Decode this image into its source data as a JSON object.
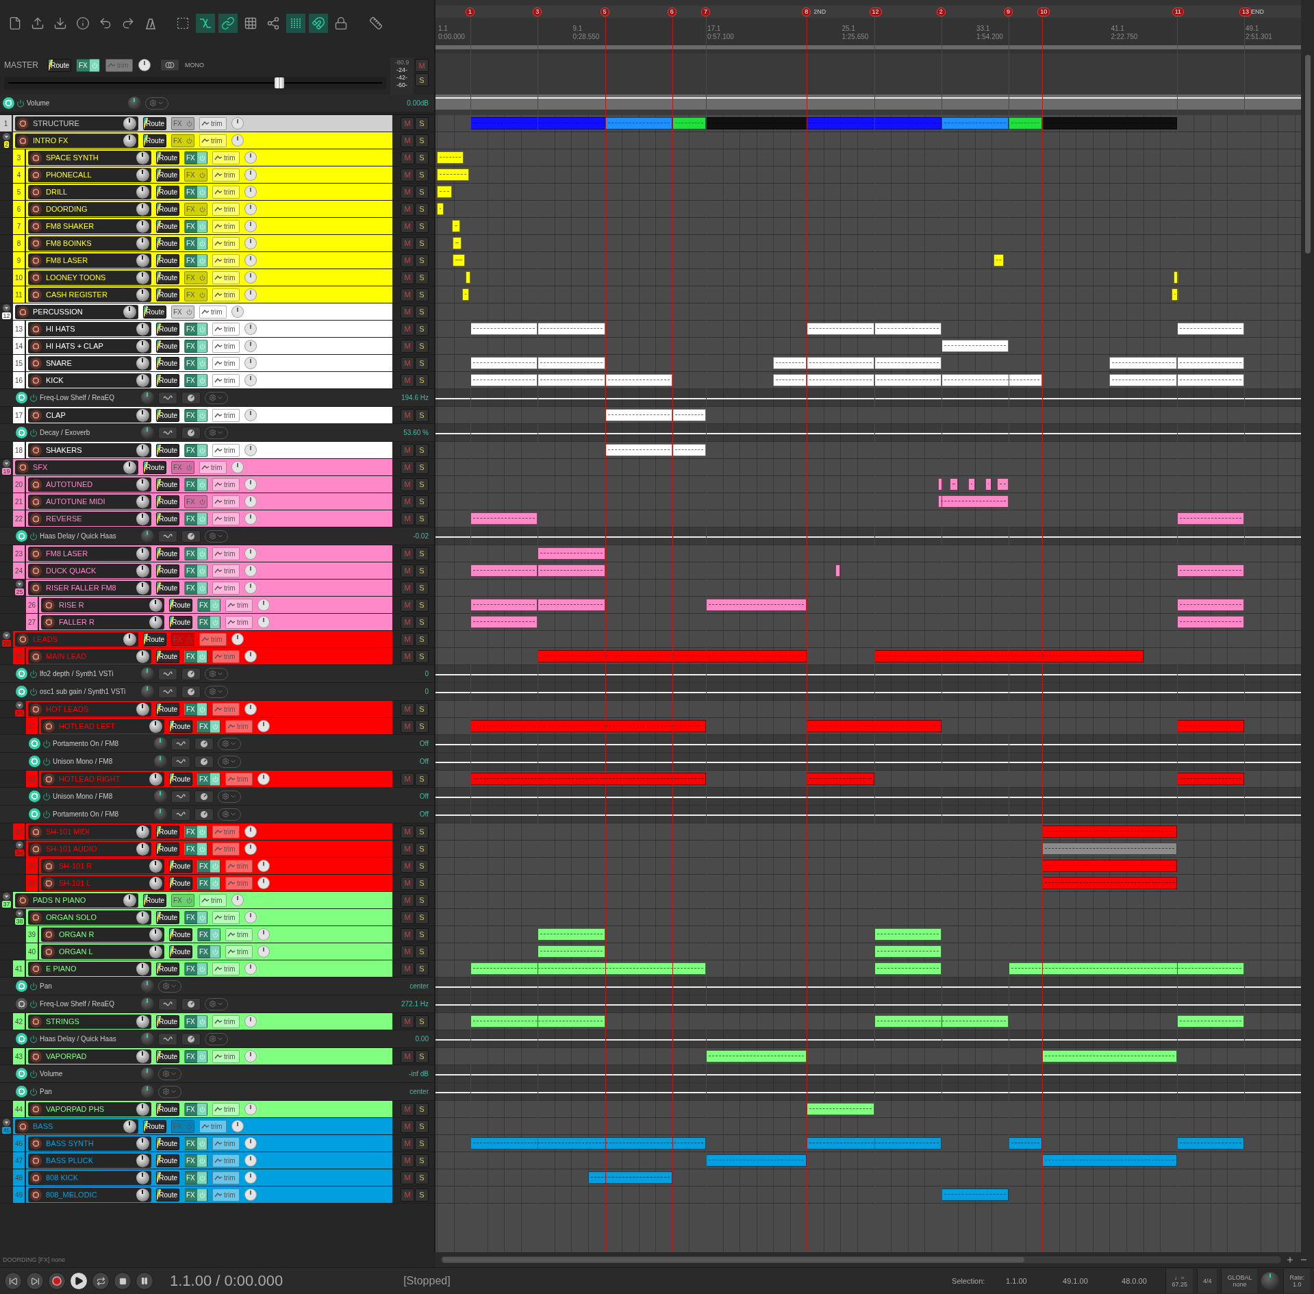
{
  "toolbar": [
    {
      "kind": "new",
      "on": false
    },
    {
      "kind": "export",
      "on": false
    },
    {
      "kind": "import",
      "on": false
    },
    {
      "kind": "info",
      "on": false
    },
    {
      "kind": "undo",
      "on": false
    },
    {
      "kind": "redo",
      "on": false
    },
    {
      "kind": "metronome",
      "on": false
    },
    {
      "kind": "marquee",
      "on": false
    },
    {
      "kind": "ripple",
      "on": true
    },
    {
      "kind": "link",
      "on": true
    },
    {
      "kind": "grid",
      "on": false
    },
    {
      "kind": "envelope_link",
      "on": false
    },
    {
      "kind": "grid_lines",
      "on": true
    },
    {
      "kind": "snap",
      "on": true
    },
    {
      "kind": "lock",
      "on": false
    },
    {
      "kind": "ruler",
      "on": false
    }
  ],
  "master": {
    "label": "MASTER",
    "buttons": [
      "Route",
      "FX",
      "trim",
      "M",
      "S"
    ],
    "mono": "MONO",
    "level": 0.72,
    "meter": [
      "-80.9",
      "-24-",
      "-42-",
      "-60-"
    ],
    "envelopes": [
      {
        "kind": "track",
        "name": "Volume",
        "value": "0.00dB",
        "active": true
      }
    ]
  },
  "ruler": [
    {
      "bar": "1.1",
      "time": "0:00.000"
    },
    {
      "bar": "9.1",
      "time": "0:28.550"
    },
    {
      "bar": "17.1",
      "time": "0:57.100"
    },
    {
      "bar": "25.1",
      "time": "1:25.650"
    },
    {
      "bar": "33.1",
      "time": "1:54.200"
    },
    {
      "bar": "41.1",
      "time": "2:22.750"
    },
    {
      "bar": "49.1",
      "time": "2:51.301"
    }
  ],
  "markers": [
    {
      "number": "1"
    },
    {
      "number": "3"
    },
    {
      "number": "5"
    },
    {
      "number": "6"
    },
    {
      "number": "7"
    },
    {
      "number": "8",
      "label": "2ND"
    },
    {
      "number": "12"
    },
    {
      "number": "2"
    },
    {
      "number": "9"
    },
    {
      "number": "10"
    },
    {
      "number": "11"
    },
    {
      "number": "13",
      "label": "END"
    }
  ],
  "tracks": [
    {
      "number": "1",
      "name": "STRUCTURE",
      "color": "#d0d0d0",
      "fx_on": false,
      "buttons": [
        "Route",
        "FX",
        "trim",
        "M",
        "S"
      ],
      "clips": [
        {
          "color": "#1010ff"
        },
        {
          "color": "#1e8fff"
        },
        {
          "color": "#20e040"
        },
        {
          "color": "#101010"
        },
        {
          "color": "#1010ff"
        },
        {
          "color": "#1e8fff"
        },
        {
          "color": "#20e040"
        },
        {
          "color": "#101010"
        }
      ]
    },
    {
      "number": "2",
      "name": "INTRO FX",
      "color": "#ffff00",
      "fx_on": false,
      "buttons": [
        "Route",
        "FX",
        "trim",
        "M",
        "S"
      ],
      "children": [
        {
          "number": "3",
          "name": "SPACE SYNTH",
          "color": "#ffff00",
          "fx_on": true,
          "buttons": [
            "Route",
            "FX",
            "trim",
            "M",
            "S"
          ]
        },
        {
          "number": "4",
          "name": "PHONECALL",
          "color": "#ffff00",
          "fx_on": false,
          "buttons": [
            "Route",
            "FX",
            "trim",
            "M",
            "S"
          ]
        },
        {
          "number": "5",
          "name": "DRILL",
          "color": "#ffff00",
          "fx_on": true,
          "buttons": [
            "Route",
            "FX",
            "trim",
            "M",
            "S"
          ]
        },
        {
          "number": "6",
          "name": "DOORDING",
          "color": "#ffff00",
          "fx_on": false,
          "buttons": [
            "Route",
            "FX",
            "trim",
            "M",
            "S"
          ]
        },
        {
          "number": "7",
          "name": "FM8 SHAKER",
          "color": "#ffff00",
          "fx_on": true,
          "buttons": [
            "Route",
            "FX",
            "trim",
            "M",
            "S"
          ]
        },
        {
          "number": "8",
          "name": "FM8 BOINKS",
          "color": "#ffff00",
          "fx_on": true,
          "buttons": [
            "Route",
            "FX",
            "trim",
            "M",
            "S"
          ]
        },
        {
          "number": "9",
          "name": "FM8 LASER",
          "color": "#ffff00",
          "fx_on": true,
          "buttons": [
            "Route",
            "FX",
            "trim",
            "M",
            "S"
          ]
        },
        {
          "number": "10",
          "name": "LOONEY TOONS",
          "color": "#ffff00",
          "fx_on": false,
          "buttons": [
            "Route",
            "FX",
            "trim",
            "M",
            "S"
          ]
        },
        {
          "number": "11",
          "name": "CASH REGISTER",
          "color": "#ffff00",
          "fx_on": false,
          "buttons": [
            "Route",
            "FX",
            "trim",
            "M",
            "S"
          ]
        }
      ]
    },
    {
      "number": "12",
      "name": "PERCUSSION",
      "color": "#ffffff",
      "fx_on": false,
      "buttons": [
        "Route",
        "FX",
        "trim",
        "M",
        "S"
      ],
      "children": [
        {
          "number": "13",
          "name": "HI HATS",
          "color": "#ffffff",
          "fx_on": true,
          "buttons": [
            "Route",
            "FX",
            "trim",
            "M",
            "S"
          ]
        },
        {
          "number": "14",
          "name": "HI HATS + CLAP",
          "color": "#ffffff",
          "fx_on": true,
          "buttons": [
            "Route",
            "FX",
            "trim",
            "M",
            "S"
          ]
        },
        {
          "number": "15",
          "name": "SNARE",
          "color": "#ffffff",
          "fx_on": true,
          "buttons": [
            "Route",
            "FX",
            "trim",
            "M",
            "S"
          ]
        },
        {
          "number": "16",
          "name": "KICK",
          "color": "#ffffff",
          "fx_on": true,
          "buttons": [
            "Route",
            "FX",
            "trim",
            "M",
            "S"
          ],
          "envelopes": [
            {
              "kind": "fx",
              "name": "Freq-Low Shelf / ReaEQ",
              "value": "194.6 Hz",
              "active": true
            }
          ]
        },
        {
          "number": "17",
          "name": "CLAP",
          "color": "#ffffff",
          "fx_on": true,
          "buttons": [
            "Route",
            "FX",
            "trim",
            "M",
            "S"
          ],
          "envelopes": [
            {
              "kind": "fx",
              "name": "Decay / Exoverb",
              "value": "53.60 %",
              "active": true
            }
          ]
        },
        {
          "number": "18",
          "name": "SHAKERS",
          "color": "#ffffff",
          "fx_on": true,
          "buttons": [
            "Route",
            "FX",
            "trim",
            "M",
            "S"
          ]
        }
      ]
    },
    {
      "number": "19",
      "name": "SFX",
      "color": "#ff88c8",
      "fx_on": false,
      "buttons": [
        "Route",
        "FX",
        "trim",
        "M",
        "S"
      ],
      "children": [
        {
          "number": "20",
          "name": "AUTOTUNED",
          "color": "#ff88c8",
          "fx_on": true,
          "buttons": [
            "Route",
            "FX",
            "trim",
            "M",
            "S"
          ]
        },
        {
          "number": "21",
          "name": "AUTOTUNE MIDI",
          "color": "#ff88c8",
          "fx_on": false,
          "buttons": [
            "Route",
            "FX",
            "trim",
            "M",
            "S"
          ]
        },
        {
          "number": "22",
          "name": "REVERSE",
          "color": "#ff88c8",
          "fx_on": true,
          "buttons": [
            "Route",
            "FX",
            "trim",
            "M",
            "S"
          ],
          "envelopes": [
            {
              "kind": "fx",
              "name": "Haas Delay / Quick Haas",
              "value": "-0.02",
              "active": true
            }
          ]
        },
        {
          "number": "23",
          "name": "FM8 LASER",
          "color": "#ff88c8",
          "fx_on": true,
          "buttons": [
            "Route",
            "FX",
            "trim",
            "M",
            "S"
          ]
        },
        {
          "number": "24",
          "name": "DUCK QUACK",
          "color": "#ff88c8",
          "fx_on": true,
          "buttons": [
            "Route",
            "FX",
            "trim",
            "M",
            "S"
          ]
        },
        {
          "number": "25",
          "name": "RISER FALLER FM8",
          "color": "#ff88c8",
          "fx_on": true,
          "buttons": [
            "Route",
            "FX",
            "trim",
            "M",
            "S"
          ],
          "children": [
            {
              "number": "26",
              "name": "RISE R",
              "color": "#ff88c8",
              "fx_on": true,
              "buttons": [
                "Route",
                "FX",
                "trim",
                "M",
                "S"
              ]
            },
            {
              "number": "27",
              "name": "FALLER R",
              "color": "#ff88c8",
              "fx_on": true,
              "buttons": [
                "Route",
                "FX",
                "trim",
                "M",
                "S"
              ]
            }
          ]
        }
      ]
    },
    {
      "number": "28",
      "name": "LEADS",
      "color": "#ff0000",
      "fx_on": false,
      "buttons": [
        "Route",
        "FX",
        "trim",
        "M",
        "S"
      ],
      "children": [
        {
          "number": "29",
          "name": "MAIN LEAD",
          "color": "#ff0000",
          "fx_on": true,
          "buttons": [
            "Route",
            "FX",
            "trim",
            "M",
            "S"
          ],
          "envelopes": [
            {
              "kind": "fx",
              "name": "lfo2 depth / Synth1 VSTi",
              "value": "0",
              "active": true
            },
            {
              "kind": "fx",
              "name": "osc1 sub gain / Synth1 VSTi",
              "value": "0",
              "active": true
            }
          ]
        },
        {
          "number": "30",
          "name": "HOT LEADS",
          "color": "#ff0000",
          "fx_on": true,
          "buttons": [
            "Route",
            "FX",
            "trim",
            "M",
            "S"
          ],
          "children": [
            {
              "number": "31",
              "name": "HOTLEAD LEFT",
              "color": "#ff0000",
              "fx_on": true,
              "buttons": [
                "Route",
                "FX",
                "trim",
                "M",
                "S"
              ],
              "envelopes": [
                {
                  "kind": "fx",
                  "name": "Portamento On / FM8",
                  "value": "Off",
                  "active": true
                },
                {
                  "kind": "fx",
                  "name": "Unison Mono / FM8",
                  "value": "Off",
                  "active": true
                }
              ]
            },
            {
              "number": "32",
              "name": "HOTLEAD RIGHT",
              "color": "#ff0000",
              "fx_on": true,
              "buttons": [
                "Route",
                "FX",
                "trim",
                "M",
                "S"
              ],
              "envelopes": [
                {
                  "kind": "fx",
                  "name": "Unison Mono / FM8",
                  "value": "Off",
                  "active": true
                },
                {
                  "kind": "fx",
                  "name": "Portamento On / FM8",
                  "value": "Off",
                  "active": true
                }
              ]
            }
          ]
        },
        {
          "number": "33",
          "name": "SH-101 MIDI",
          "color": "#ff0000",
          "fx_on": true,
          "buttons": [
            "Route",
            "FX",
            "trim",
            "M",
            "S"
          ]
        },
        {
          "number": "34",
          "name": "SH-101 AUDIO",
          "color": "#ff0000",
          "fx_on": true,
          "buttons": [
            "Route",
            "FX",
            "trim",
            "M",
            "S"
          ],
          "clips": [
            {
              "color": "#8a8a8a"
            }
          ],
          "children": [
            {
              "number": "35",
              "name": "SH-101 R",
              "color": "#ff0000",
              "fx_on": true,
              "buttons": [
                "Route",
                "FX",
                "trim",
                "M",
                "S"
              ]
            },
            {
              "number": "36",
              "name": "SH-101 L",
              "color": "#ff0000",
              "fx_on": true,
              "buttons": [
                "Route",
                "FX",
                "trim",
                "M",
                "S"
              ]
            }
          ]
        }
      ]
    },
    {
      "number": "37",
      "name": "PADS N PIANO",
      "color": "#80ff80",
      "fx_on": false,
      "buttons": [
        "Route",
        "FX",
        "trim",
        "M",
        "S"
      ],
      "children": [
        {
          "number": "38",
          "name": "ORGAN SOLO",
          "color": "#80ff80",
          "fx_on": true,
          "buttons": [
            "Route",
            "FX",
            "trim",
            "M",
            "S"
          ],
          "children": [
            {
              "number": "39",
              "name": "ORGAN R",
              "color": "#80ff80",
              "fx_on": true,
              "buttons": [
                "Route",
                "FX",
                "trim",
                "M",
                "S"
              ]
            },
            {
              "number": "40",
              "name": "ORGAN L",
              "color": "#80ff80",
              "fx_on": true,
              "buttons": [
                "Route",
                "FX",
                "trim",
                "M",
                "S"
              ]
            }
          ]
        },
        {
          "number": "41",
          "name": "E PIANO",
          "color": "#80ff80",
          "fx_on": true,
          "buttons": [
            "Route",
            "FX",
            "trim",
            "M",
            "S"
          ],
          "envelopes": [
            {
              "kind": "track",
              "name": "Pan",
              "value": "center",
              "active": true
            },
            {
              "kind": "fx",
              "name": "Freq-Low Shelf / ReaEQ",
              "value": "272.1 Hz",
              "active": false
            }
          ]
        },
        {
          "number": "42",
          "name": "STRINGS",
          "color": "#80ff80",
          "fx_on": true,
          "buttons": [
            "Route",
            "FX",
            "trim",
            "M",
            "S"
          ],
          "envelopes": [
            {
              "kind": "fx",
              "name": "Haas Delay / Quick Haas",
              "value": "0.00",
              "active": true
            }
          ]
        },
        {
          "number": "43",
          "name": "VAPORPAD",
          "color": "#80ff80",
          "fx_on": true,
          "buttons": [
            "Route",
            "FX",
            "trim",
            "M",
            "S"
          ],
          "envelopes": [
            {
              "kind": "track",
              "name": "Volume",
              "value": "-inf dB",
              "active": true
            },
            {
              "kind": "track",
              "name": "Pan",
              "value": "center",
              "active": true
            }
          ]
        },
        {
          "number": "44",
          "name": "VAPORPAD PHS",
          "color": "#80ff80",
          "fx_on": true,
          "buttons": [
            "Route",
            "FX",
            "trim",
            "M",
            "S"
          ]
        }
      ]
    },
    {
      "number": "45",
      "name": "BASS",
      "color": "#00a0e0",
      "fx_on": false,
      "buttons": [
        "Route",
        "FX",
        "trim",
        "M",
        "S"
      ],
      "children": [
        {
          "number": "46",
          "name": "BASS SYNTH",
          "color": "#00a0e0",
          "fx_on": true,
          "buttons": [
            "Route",
            "FX",
            "trim",
            "M",
            "S"
          ]
        },
        {
          "number": "47",
          "name": "BASS PLUCK",
          "color": "#00a0e0",
          "fx_on": true,
          "buttons": [
            "Route",
            "FX",
            "trim",
            "M",
            "S"
          ]
        },
        {
          "number": "48",
          "name": "808 KICK",
          "color": "#00a0e0",
          "fx_on": true,
          "buttons": [
            "Route",
            "FX",
            "trim",
            "M",
            "S"
          ]
        },
        {
          "number": "49",
          "name": "808_MELODIC",
          "color": "#00a0e0",
          "fx_on": true,
          "buttons": [
            "Route",
            "FX",
            "trim",
            "M",
            "S"
          ]
        }
      ]
    }
  ],
  "status_text": "DOORDING [FX] none",
  "transport": {
    "buttons": [
      {
        "kind": "skip_back"
      },
      {
        "kind": "skip_forward"
      },
      {
        "kind": "record"
      },
      {
        "kind": "play"
      },
      {
        "kind": "loop"
      },
      {
        "kind": "stop"
      },
      {
        "kind": "pause"
      }
    ],
    "position": "1.1.00 / 0:00.000",
    "state": "[Stopped]",
    "selection_label": "Selection:",
    "selection": [
      "1.1.00",
      "49.1.00",
      "48.0.00"
    ],
    "tempo_glyph": "♩=",
    "tempo": "67.25",
    "time_signature": "4/4",
    "automation": "GLOBAL",
    "automation_mode": "none",
    "rate_label": "Rate:",
    "rate": "1.0"
  }
}
